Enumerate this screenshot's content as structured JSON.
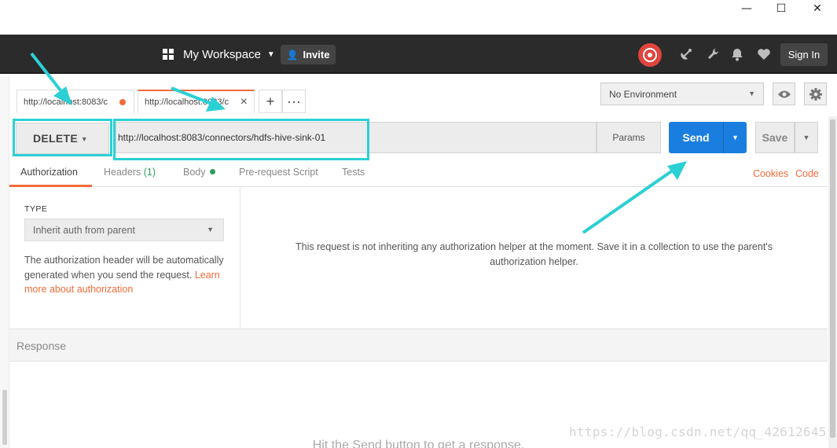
{
  "window": {
    "minimize": "—",
    "maximize": "☐",
    "close": "✕"
  },
  "header": {
    "workspace": "My Workspace",
    "invite": "Invite",
    "sign_in": "Sign In",
    "icons": [
      "sync-icon",
      "satellite-icon",
      "wrench-icon",
      "bell-icon",
      "heart-icon"
    ]
  },
  "tabs": [
    {
      "label": "http://localhost:8083/c",
      "unsaved": true
    },
    {
      "label": "http://localhost:8083/c",
      "active": true
    }
  ],
  "environment": {
    "selected": "No Environment"
  },
  "request": {
    "method": "DELETE",
    "url": "http://localhost:8083/connectors/hdfs-hive-sink-01",
    "params": "Params",
    "send": "Send",
    "save": "Save"
  },
  "subtabs": {
    "authorization": "Authorization",
    "headers": "Headers",
    "headers_count": "(1)",
    "body": "Body",
    "prerequest": "Pre-request Script",
    "tests": "Tests",
    "cookies": "Cookies",
    "code": "Code"
  },
  "auth": {
    "type_label": "TYPE",
    "type_value": "Inherit auth from parent",
    "help": "The authorization header will be automatically generated when you send the request. ",
    "help_link": "Learn more about authorization",
    "message": "This request is not inheriting any authorization helper at the moment. Save it in a collection to use the parent's authorization helper."
  },
  "response": {
    "title": "Response",
    "hint": "Hit the Send button to get a response."
  },
  "watermark": "https://blog.csdn.net/qq_42612645",
  "colors": {
    "accent": "#f26b3a",
    "send_blue": "#1a7ee0",
    "highlight": "#2bd0d5",
    "header_bg": "#2b2b2b"
  }
}
